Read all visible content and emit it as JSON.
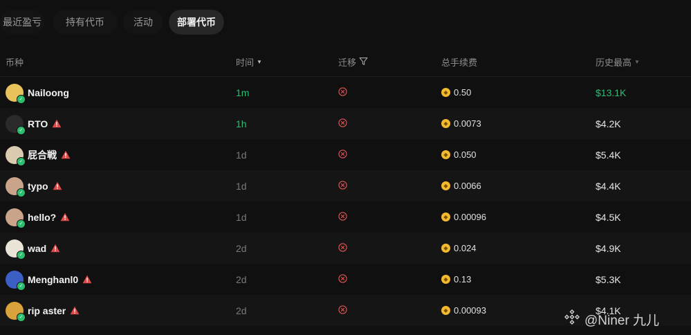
{
  "tabs": [
    {
      "label": "最近盈亏",
      "active": false
    },
    {
      "label": "持有代币",
      "active": false
    },
    {
      "label": "活动",
      "active": false
    },
    {
      "label": "部署代币",
      "active": true
    }
  ],
  "table": {
    "columns": {
      "token": "币种",
      "time": "时间",
      "migrate": "迁移",
      "fees": "总手续费",
      "ath": "历史最高"
    },
    "rows": [
      {
        "name": "Nailoong",
        "warning": false,
        "time": "1m",
        "migrated": false,
        "fee": "0.50",
        "ath": "$13.1K",
        "ath_color": "#2ebd75",
        "time_color": "#2ebd75",
        "avatar_color": "#e8c25a"
      },
      {
        "name": "RTO",
        "warning": true,
        "time": "1h",
        "migrated": false,
        "fee": "0.0073",
        "ath": "$4.2K",
        "ath_color": "#e6e6e6",
        "time_color": "#2ebd75",
        "avatar_color": "#2a2a2a"
      },
      {
        "name": "屁合戦",
        "warning": true,
        "time": "1d",
        "migrated": false,
        "fee": "0.050",
        "ath": "$5.4K",
        "ath_color": "#e6e6e6",
        "time_color": "#7a7a7a",
        "avatar_color": "#d8cbb0"
      },
      {
        "name": "typo",
        "warning": true,
        "time": "1d",
        "migrated": false,
        "fee": "0.0066",
        "ath": "$4.4K",
        "ath_color": "#e6e6e6",
        "time_color": "#7a7a7a",
        "avatar_color": "#c9a48a"
      },
      {
        "name": "hello?",
        "warning": true,
        "time": "1d",
        "migrated": false,
        "fee": "0.00096",
        "ath": "$4.5K",
        "ath_color": "#e6e6e6",
        "time_color": "#7a7a7a",
        "avatar_color": "#c9a48a"
      },
      {
        "name": "wad",
        "warning": true,
        "time": "2d",
        "migrated": false,
        "fee": "0.024",
        "ath": "$4.9K",
        "ath_color": "#e6e6e6",
        "time_color": "#7a7a7a",
        "avatar_color": "#e9e4d6"
      },
      {
        "name": "Menghanl0",
        "warning": true,
        "time": "2d",
        "migrated": false,
        "fee": "0.13",
        "ath": "$5.3K",
        "ath_color": "#e6e6e6",
        "time_color": "#7a7a7a",
        "avatar_color": "#3b5fc4"
      },
      {
        "name": "rip aster",
        "warning": true,
        "time": "2d",
        "migrated": false,
        "fee": "0.00093",
        "ath": "$4.1K",
        "ath_color": "#e6e6e6",
        "time_color": "#7a7a7a",
        "avatar_color": "#d9a23a"
      }
    ]
  },
  "colors": {
    "background": "#101010",
    "positive": "#2ebd75",
    "warning": "#e04848",
    "migrate_fail": "#e05555",
    "coin": "#f3ba2f"
  },
  "icons": {
    "time_sort": "caret-down-icon",
    "migrate_filter": "filter-icon",
    "ath_sort": "caret-down-icon",
    "warning": "warning-triangle-icon",
    "migrate_status": "x-circle-icon",
    "fee_currency": "bnb-coin-icon",
    "verified": "verified-badge-icon"
  },
  "watermark": {
    "text": "@Niner 九儿"
  }
}
